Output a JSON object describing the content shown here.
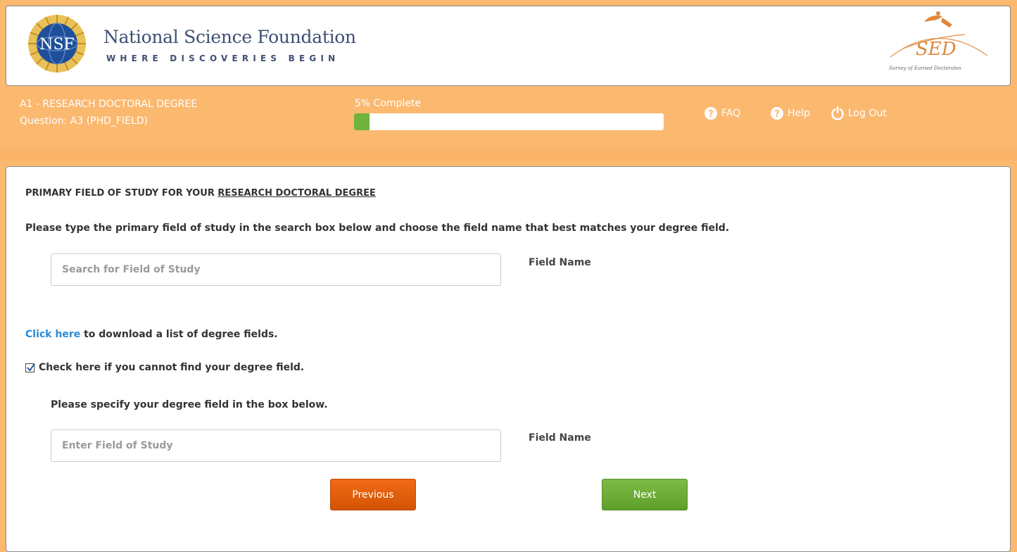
{
  "header": {
    "org_name": "National Science Foundation",
    "tagline": "WHERE DISCOVERIES BEGIN",
    "nsf_logo_text": "NSF",
    "sed_logo_text": "SED",
    "sed_logo_subtext": "Survey of Earned Doctorates"
  },
  "status": {
    "section_title": "A1 - RESEARCH DOCTORAL DEGREE",
    "question_id": "Question: A3 (PHD_FIELD)",
    "progress_label": "5% Complete",
    "progress_fraction": 0.05
  },
  "nav": {
    "faq_label": "FAQ",
    "help_label": "Help",
    "logout_label": "Log Out",
    "faq_icon": "question-circle-icon",
    "help_icon": "question-circle-icon",
    "logout_icon": "power-icon"
  },
  "question": {
    "heading_prefix": "PRIMARY FIELD OF STUDY FOR YOUR ",
    "heading_underlined": "RESEARCH DOCTORAL DEGREE",
    "instruction": "Please type the primary field of study in the search box below and choose the field name that best matches your degree field.",
    "search_placeholder": "Search for Field of Study",
    "search_value": "",
    "field_name_label": "Field Name",
    "download_link": "Click here",
    "download_text": " to download a list of degree fields.",
    "cannot_find_label": "Check here if you cannot find your degree field.",
    "cannot_find_checked": true,
    "specify_text": "Please specify your degree field in the box below.",
    "enter_placeholder": "Enter Field of Study",
    "enter_value": "",
    "field_name_label_2": "Field Name"
  },
  "buttons": {
    "previous": "Previous",
    "next": "Next"
  },
  "colors": {
    "band": "#fbb86f",
    "progress_fill": "#6fb33a",
    "previous_button": "#e35f0d",
    "next_button": "#6aae36",
    "link": "#2a8bd6"
  }
}
